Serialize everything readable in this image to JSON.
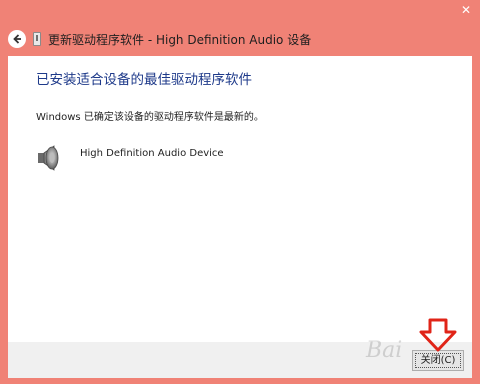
{
  "window": {
    "close_glyph": "✕",
    "title": "更新驱动程序软件 - High Definition Audio 设备"
  },
  "content": {
    "heading": "已安装适合设备的最佳驱动程序软件",
    "message": "Windows 已确定该设备的驱动程序软件是最新的。",
    "device_name": "High Definition Audio Device"
  },
  "footer": {
    "close_label": "关闭(C)"
  },
  "watermark": {
    "text": "Bai"
  },
  "colors": {
    "frame": "#f08276",
    "arrow": "#e02418",
    "heading": "#1e3a8a"
  }
}
